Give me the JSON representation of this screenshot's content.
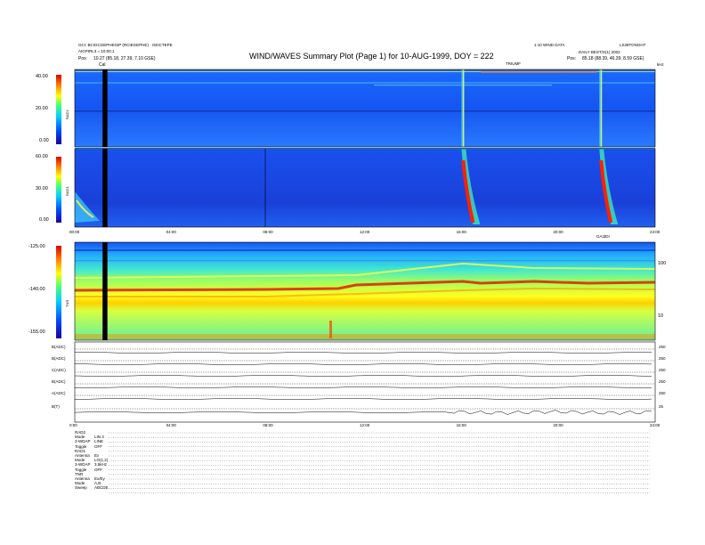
{
  "header": {
    "title": "WIND/WAVES Summary Plot (Page 1) for 10-AUG-1999, DOY = 222",
    "left_line1": "GCI: BCIGCGEPHEGIP (RCIEGEPHE) · GEICTEPE",
    "left_line2": "AIGPIRL3 = 10:00:1",
    "left_pos_label": "Pos:",
    "left_pos_value": "10.27 (85.18, 27.39, 7.10 GSE)",
    "right_line1": "1:10 WIND DATA",
    "right_line2": "LS38TONGHT",
    "right_line3": "DAILY BEST/S(1) 2002",
    "right_pos_label": "Pos:",
    "right_pos_value": "85.18 (88.39, 46.39, 8.59 GSE)",
    "cal_marker": "Cal",
    "top_center_label": "TRIUMF",
    "khz_label": "kHz"
  },
  "panels": {
    "rad2": {
      "name": "RAD2",
      "ticks": [
        "40.00",
        "20.00",
        "0.00"
      ]
    },
    "rad1": {
      "name": "RAD1",
      "ticks": [
        "60.00",
        "30.00",
        "0.00"
      ]
    },
    "tnr": {
      "name": "TNR",
      "ticks": [
        "-125.00",
        "-140.00",
        "-155.00"
      ],
      "right_ticks": [
        "100",
        "10"
      ]
    }
  },
  "time_ticks_mid": [
    "00:00",
    "04:00",
    "08:00",
    "12:00",
    "16:00",
    "20:00",
    "24:00"
  ],
  "right_mid_label": "GAI3DI",
  "aux_rows": [
    {
      "label": "B(ADC)",
      "right": "250"
    },
    {
      "label": "B(ADC)",
      "right": "250"
    },
    {
      "label": "C(ADC)",
      "right": "250"
    },
    {
      "label": "B(ADC)",
      "right": "250"
    },
    {
      "label": "A(ADC)",
      "right": "250"
    },
    {
      "label": "B(T)",
      "right": "25"
    }
  ],
  "time_ticks_bottom": [
    "0:00",
    "04:00",
    "08:00",
    "12:00",
    "16:00",
    "20:00",
    "24:00"
  ],
  "footer_sections": [
    {
      "heading": "RAD2",
      "rows": [
        [
          "Mode",
          "LIN 3"
        ],
        [
          "3-WDAP",
          "LINE"
        ],
        [
          "Toggle",
          "OFF"
        ]
      ]
    },
    {
      "heading": "RAD1",
      "rows": [
        [
          "Antenna",
          "Ex"
        ],
        [
          "Mode",
          "LO(1,2)"
        ],
        [
          "3-WDAP",
          "3,5kHz"
        ],
        [
          "Toggle",
          "OFF"
        ]
      ]
    },
    {
      "heading": "TNR",
      "rows": [
        [
          "Antenna",
          "Ex/Ey"
        ],
        [
          "Mode",
          "A,B"
        ],
        [
          "Sweep",
          "ABCDE"
        ]
      ]
    }
  ],
  "chart_data": {
    "type": "heatmap",
    "title": "WIND/WAVES Summary Plot (Page 1) for 10-AUG-1999, DOY = 222",
    "x_range_hours": [
      0,
      24
    ],
    "x_ticks": [
      "00:00",
      "04:00",
      "08:00",
      "12:00",
      "16:00",
      "20:00",
      "24:00"
    ],
    "panels": [
      {
        "name": "RAD2",
        "y_ticks": [
          40.0,
          20.0,
          0.0
        ],
        "ylim": [
          0,
          40
        ]
      },
      {
        "name": "RAD1",
        "y_ticks": [
          60.0,
          30.0,
          0.0
        ],
        "ylim": [
          0,
          60
        ]
      },
      {
        "name": "TNR",
        "y_ticks": [
          -125.0,
          -140.0,
          -155.0
        ],
        "ylim": [
          -155,
          -125
        ]
      }
    ],
    "colorbar": [
      "#1a00a0",
      "#0040ff",
      "#00c8ff",
      "#00ff80",
      "#ffff00",
      "#ff8000",
      "#e00000"
    ],
    "bursts_hours": [
      16.1,
      21.8
    ],
    "data_gap_hours": [
      1.15,
      1.35
    ]
  }
}
